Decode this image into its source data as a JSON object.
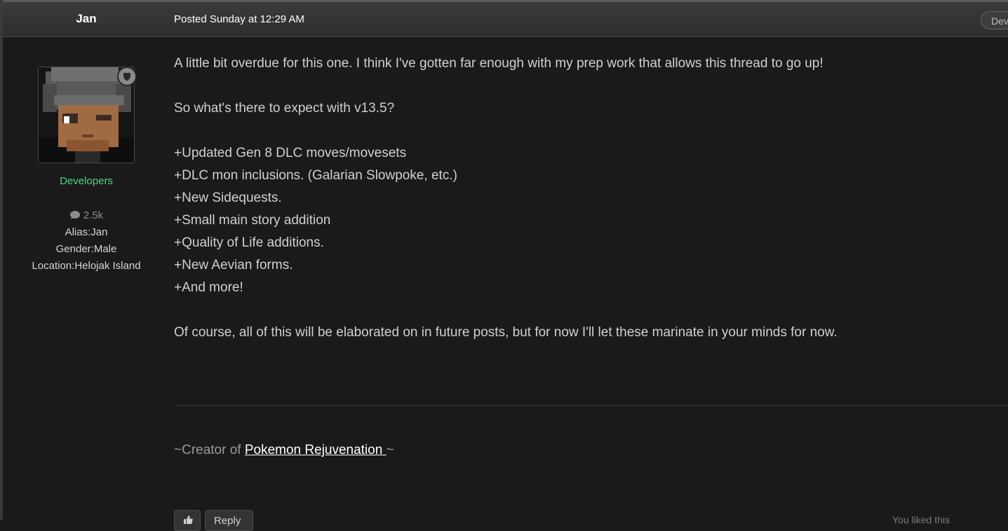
{
  "post": {
    "author": "Jan",
    "posted_label": "Posted Sunday at 12:29 AM",
    "badge_label": "Developers"
  },
  "sidebar": {
    "group": "Developers",
    "post_count": "2.5k",
    "alias": "Alias:Jan",
    "gender": "Gender:Male",
    "location": "Location:Helojak Island"
  },
  "body": {
    "intro": "A little bit overdue for this one. I think I've gotten far enough with my prep work that allows this thread to go up!",
    "question": "So what's there to expect with v13.5?",
    "features": [
      "+Updated Gen 8 DLC moves/movesets",
      "+DLC mon inclusions. (Galarian Slowpoke, etc.)",
      "+New Sidequests.",
      "+Small main story addition",
      "+Quality of Life additions.",
      "+New Aevian forms.",
      "+And more!"
    ],
    "closing": "Of course, all of this will be elaborated on in future posts, but for now I'll let these marinate in your minds for now."
  },
  "signature": {
    "prefix": "~Creator of ",
    "link_text": "Pokemon Rejuvenation ",
    "suffix": "~"
  },
  "actions": {
    "reply_label": "Reply",
    "footer_note": "You liked this"
  },
  "colors": {
    "background": "#1a1a1a",
    "header": "#333333",
    "group": "#4cd980",
    "text": "#d0d0d0"
  }
}
